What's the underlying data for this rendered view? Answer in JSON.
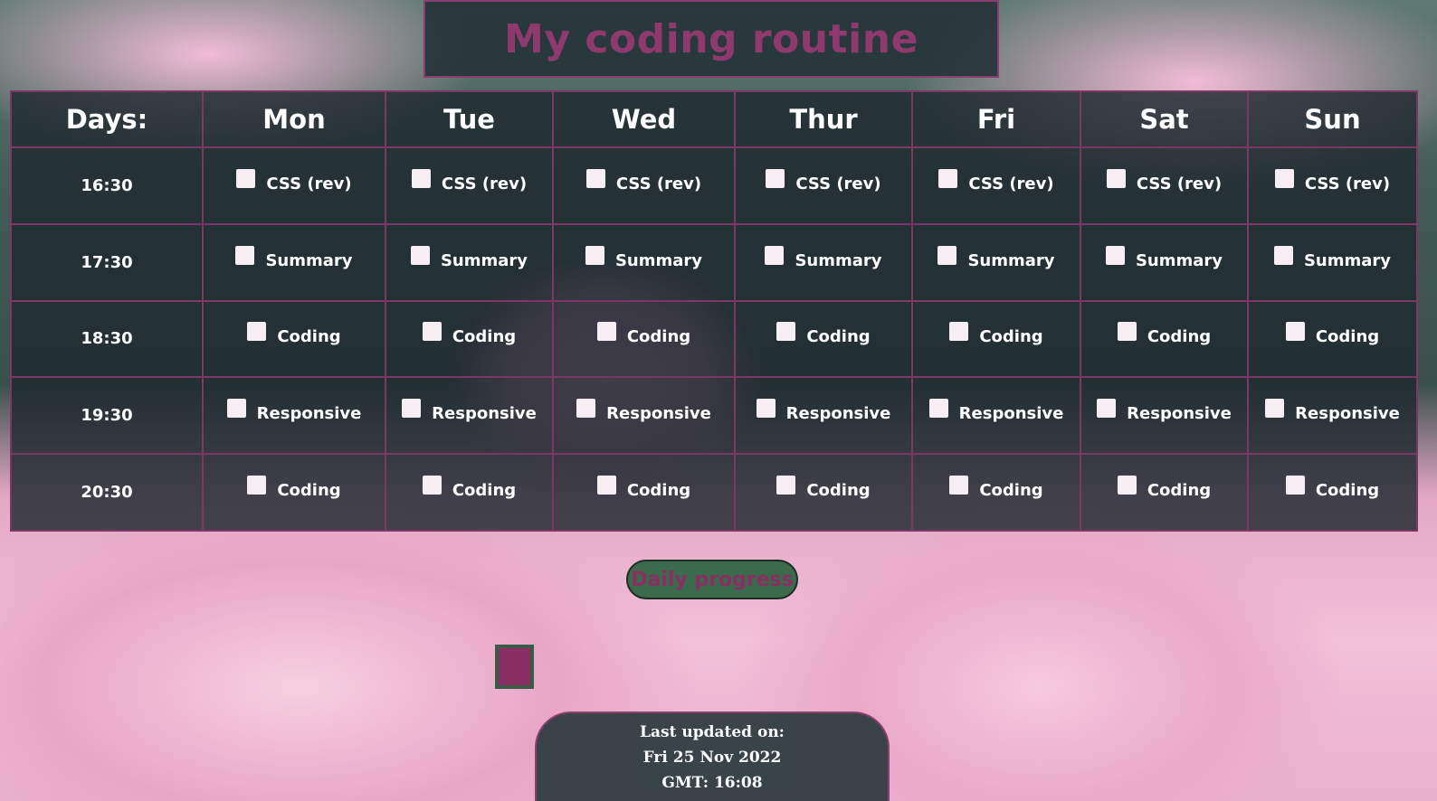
{
  "title": "My coding routine",
  "table": {
    "days_label": "Days:",
    "days": [
      "Mon",
      "Tue",
      "Wed",
      "Thur",
      "Fri",
      "Sat",
      "Sun"
    ],
    "rows": [
      {
        "time": "16:30",
        "task": "CSS (rev)"
      },
      {
        "time": "17:30",
        "task": "Summary"
      },
      {
        "time": "18:30",
        "task": "Coding"
      },
      {
        "time": "19:30",
        "task": "Responsive"
      },
      {
        "time": "20:30",
        "task": "Coding"
      }
    ]
  },
  "progress": {
    "button_label": "Daily progress",
    "accent_color": "#8a2f62"
  },
  "footer": {
    "line1": "Last updated on:",
    "line2": "Fri 25 Nov 2022",
    "line3": "GMT: 16:08"
  }
}
